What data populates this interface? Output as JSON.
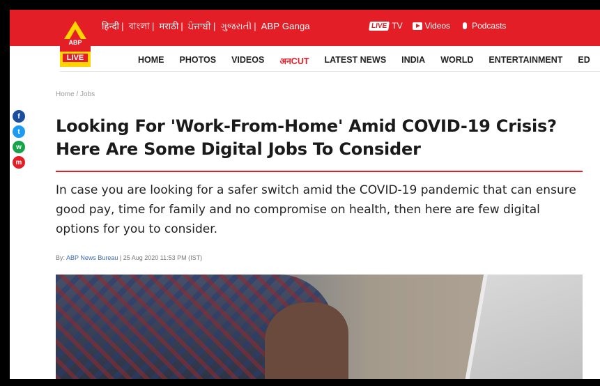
{
  "header": {
    "languages": [
      "हिन्दी",
      "বাংলা",
      "मराठी",
      "ਪੰਜਾਬੀ",
      "ગુજરાતી",
      "ABP Ganga"
    ],
    "live_badge": "LIVE",
    "tv_label": "TV",
    "videos_label": "Videos",
    "podcasts_label": "Podcasts",
    "logo_abp": "ABP",
    "logo_live": "LIVE",
    "accent_color": "#e41e26"
  },
  "nav": {
    "items": [
      "HOME",
      "PHOTOS",
      "VIDEOS",
      "अनCUT",
      "LATEST NEWS",
      "INDIA",
      "WORLD",
      "ENTERTAINMENT",
      "ED"
    ]
  },
  "breadcrumb": "Home / Jobs",
  "share": [
    "f",
    "t",
    "w",
    "m"
  ],
  "article": {
    "headline": "Looking For 'Work-From-Home' Amid COVID-19 Crisis? Here Are Some Digital Jobs To Consider",
    "summary": "In case you are looking for a safer switch amid the COVID-19 pandemic that can ensure good pay, time for family and no compromise on health, then here are few digital options for you to consider.",
    "byline_prefix": "By: ",
    "author": "ABP News Bureau",
    "timestamp": " | 25 Aug 2020 11:53 PM (IST)"
  }
}
